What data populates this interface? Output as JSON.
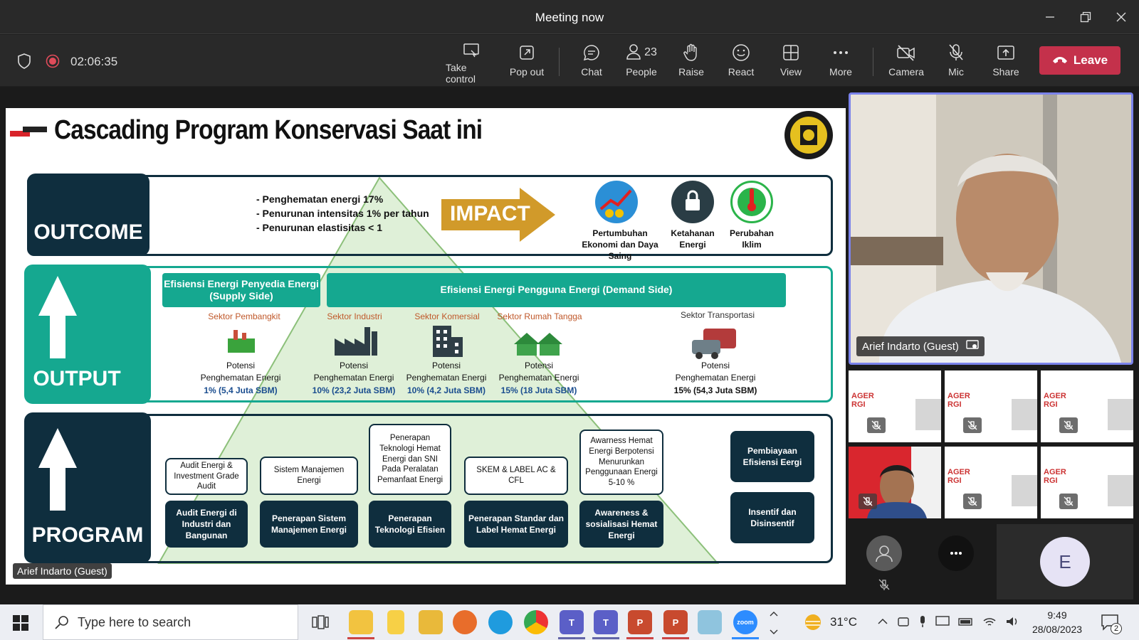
{
  "window": {
    "title": "Meeting now"
  },
  "toolbar": {
    "timer": "02:06:35",
    "take_control": "Take control",
    "pop_out": "Pop out",
    "chat": "Chat",
    "people": "People",
    "people_count": "23",
    "raise": "Raise",
    "react": "React",
    "view": "View",
    "more": "More",
    "camera": "Camera",
    "mic": "Mic",
    "share": "Share",
    "leave": "Leave"
  },
  "slide": {
    "title": "Cascading Program Konservasi Saat ini",
    "outcome": {
      "label": "OUTCOME",
      "bullets": [
        "- Penghematan energi 17%",
        "- Penurunan intensitas 1% per tahun",
        "- Penurunan elastisitas < 1"
      ],
      "impact": "IMPACT",
      "impacts": [
        "Pertumbuhan Ekonomi dan Daya Saing",
        "Ketahanan Energi",
        "Perubahan Iklim"
      ]
    },
    "output": {
      "label": "OUTPUT",
      "supply": "Efisiensi Energi Penyedia Energi (Supply Side)",
      "demand": "Efisiensi Energi Pengguna Energi (Demand Side)",
      "sectors": [
        {
          "name": "Sektor Pembangkit",
          "line1": "Potensi",
          "line2": "Penghematan Energi",
          "value": "1% (5,4 Juta SBM)"
        },
        {
          "name": "Sektor Industri",
          "line1": "Potensi",
          "line2": "Penghematan Energi",
          "value": "10% (23,2 Juta SBM)"
        },
        {
          "name": "Sektor Komersial",
          "line1": "Potensi",
          "line2": "Penghematan Energi",
          "value": "10% (4,2 Juta SBM)"
        },
        {
          "name": "Sektor Rumah Tangga",
          "line1": "Potensi",
          "line2": "Penghematan Energi",
          "value": "15% (18 Juta SBM)"
        },
        {
          "name": "Sektor Transportasi",
          "line1": "Potensi",
          "line2": "Penghematan Energi",
          "value": "15% (54,3 Juta SBM)"
        }
      ]
    },
    "program": {
      "label": "PROGRAM",
      "upper": [
        "Audit Energi & Investment Grade Audit",
        "Sistem Manajemen Energi",
        "Penerapan Teknologi Hemat Energi dan SNI Pada Peralatan Pemanfaat Energi",
        "SKEM & LABEL AC & CFL",
        "Awarness Hemat Energi Berpotensi Menurunkan Penggunaan Energi 5-10 %"
      ],
      "lower": [
        "Audit Energi di Industri dan Bangunan",
        "Penerapan Sistem Manajemen Energi",
        "Penerapan Teknologi Efisien",
        "Penerapan Standar dan Label Hemat Energi",
        "Awareness & sosialisasi Hemat Energi"
      ],
      "side": [
        "Pembiayaan Efisiensi Eergi",
        "Insentif dan Disinsentif"
      ]
    },
    "presenter_label": "Arief Indarto (Guest)"
  },
  "video": {
    "main_name": "Arief Indarto (Guest)",
    "avatar_letter": "E"
  },
  "taskbar": {
    "search_placeholder": "Type here to search",
    "weather": "31°C",
    "time": "9:49",
    "date": "28/08/2023",
    "notifications": "2"
  },
  "colors": {
    "leave": "#c4314b",
    "accent": "#7b83eb",
    "teal": "#15a890",
    "navy": "#0f2e3e"
  }
}
